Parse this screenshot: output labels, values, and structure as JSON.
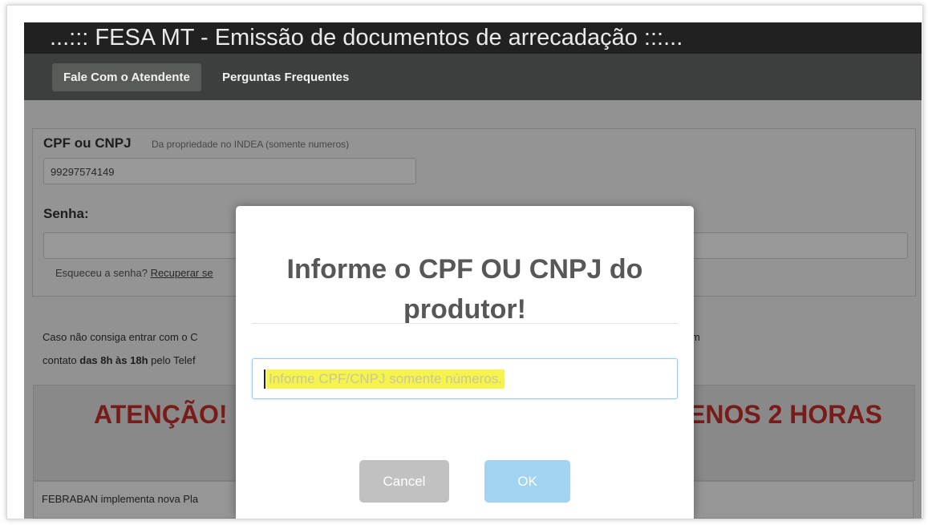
{
  "header": {
    "title": "...::: FESA MT - Emissão de documentos de arrecadação :::..."
  },
  "nav": {
    "items": [
      "Fale Com o Atendente",
      "Perguntas Frequentes"
    ]
  },
  "form": {
    "cpf_label": "CPF ou CNPJ",
    "cpf_hint": "Da propriedade no INDEA (somente numeros)",
    "cpf_value": "99297574149",
    "senha_label": "Senha:",
    "forgot_text": "Esqueceu a senha?",
    "forgot_link": "Recuperar se"
  },
  "info": {
    "line1_left": "Caso não consiga entrar com o C",
    "line1_right": "m",
    "line2_prefix": "contato ",
    "line2_bold": "das 8h às 18h",
    "line2_suffix": " pelo Telef"
  },
  "alert": {
    "left": "ATENÇÃO! R",
    "right": "ENOS 2 HORAS"
  },
  "news": {
    "text": "FEBRABAN implementa nova Pla"
  },
  "modal": {
    "title": "Informe o CPF OU CNPJ do produtor!",
    "input_placeholder": "Informe CPF/CNPJ somente números.",
    "cancel_label": "Cancel",
    "ok_label": "OK"
  },
  "colors": {
    "alert_red": "#c9302c",
    "highlight": "#f6f44a",
    "ok_button": "#a2d3f0",
    "cancel_button": "#c1c1c1"
  }
}
